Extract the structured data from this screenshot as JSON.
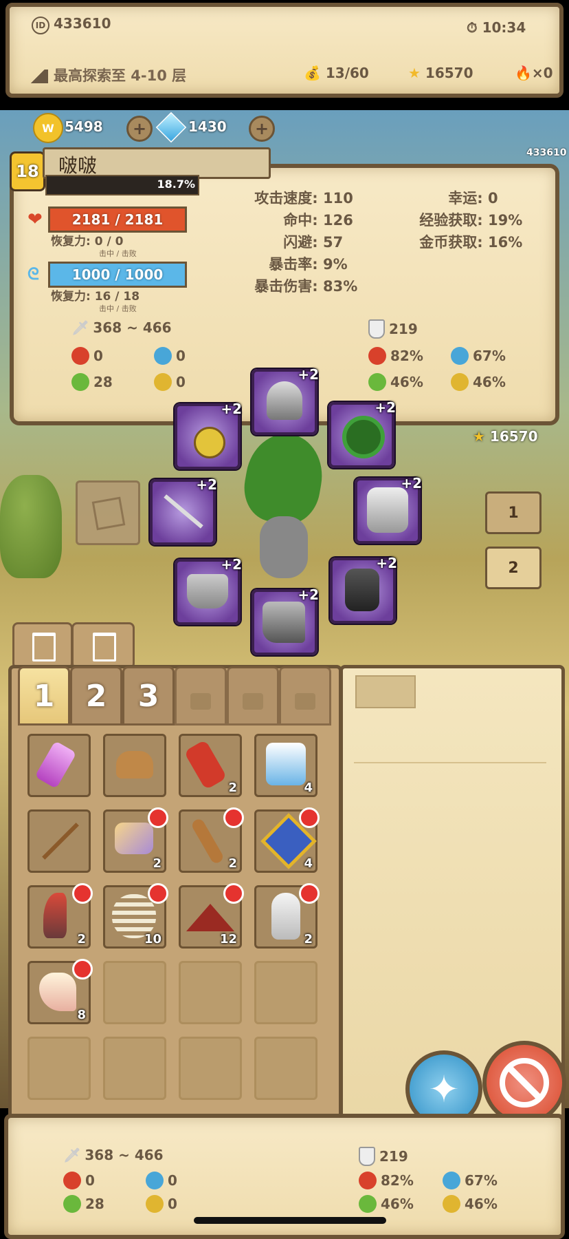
{
  "top": {
    "player_id": "433610",
    "time": "10:34",
    "max_explore": "最高探索至 4-10 层",
    "bag": "13/60",
    "stars": "16570",
    "fire": "×0"
  },
  "currency": {
    "gold": "5498",
    "gems": "1430"
  },
  "hero": {
    "level": "18",
    "name": "啵啵",
    "exp_percent": "18.7%",
    "id_small": "433610",
    "hp": "2181 / 2181",
    "hp_regen": "恢复力: 0 / 0",
    "hp_regen_sub": "击中 / 击败",
    "mp": "1000 / 1000",
    "mp_regen": "恢复力: 16 / 18",
    "mp_regen_sub": "击中 / 击败"
  },
  "stats_mid": [
    {
      "label": "攻击速度:",
      "value": "110"
    },
    {
      "label": "命中:",
      "value": "126"
    },
    {
      "label": "闪避:",
      "value": "57"
    },
    {
      "label": "暴击率:",
      "value": "9%"
    },
    {
      "label": "暴击伤害:",
      "value": "83%"
    }
  ],
  "stats_right": [
    {
      "label": "幸运:",
      "value": "0"
    },
    {
      "label": "经验获取:",
      "value": "19%"
    },
    {
      "label": "金币获取:",
      "value": "16%"
    }
  ],
  "combat": {
    "attack": "368 ~ 466",
    "defense": "219",
    "fire_atk": "0",
    "ice_atk": "0",
    "poison_atk": "0",
    "lightning_atk": "0",
    "fire_res": "82%",
    "ice_res": "67%",
    "poison_res": "46%",
    "lightning_res": "46%",
    "poison_atk_val": "28"
  },
  "equipment_plus": "+2",
  "side": {
    "stars": "16570",
    "set1": "1",
    "set2": "2"
  },
  "tabs": [
    "1",
    "2",
    "3"
  ],
  "inventory": [
    {
      "icon": "potion-icon",
      "count": ""
    },
    {
      "icon": "stump-icon",
      "count": ""
    },
    {
      "icon": "scroll-icon",
      "count": "2"
    },
    {
      "icon": "crystal-armor-icon",
      "count": "4"
    },
    {
      "icon": "spear-icon",
      "count": ""
    },
    {
      "icon": "ore-icon",
      "count": "2"
    },
    {
      "icon": "club-icon",
      "count": "2"
    },
    {
      "icon": "amulet-icon",
      "count": "4"
    },
    {
      "icon": "horn-icon",
      "count": "2"
    },
    {
      "icon": "ribcage-icon",
      "count": "10"
    },
    {
      "icon": "dust-icon",
      "count": "12"
    },
    {
      "icon": "claw-icon",
      "count": "2"
    },
    {
      "icon": "fangs-icon",
      "count": "8"
    }
  ],
  "bottom": {
    "attack": "368 ~ 466",
    "defense": "219",
    "fire_atk": "0",
    "ice_atk": "0",
    "poison_atk": "28",
    "lightning_atk": "0",
    "fire_res": "82%",
    "ice_res": "67%",
    "poison_res": "46%",
    "lightning_res": "46%"
  },
  "colors": {
    "hp": "#e0542c",
    "mp": "#5bb7e8",
    "purple_slot": "#6d3f9c"
  }
}
